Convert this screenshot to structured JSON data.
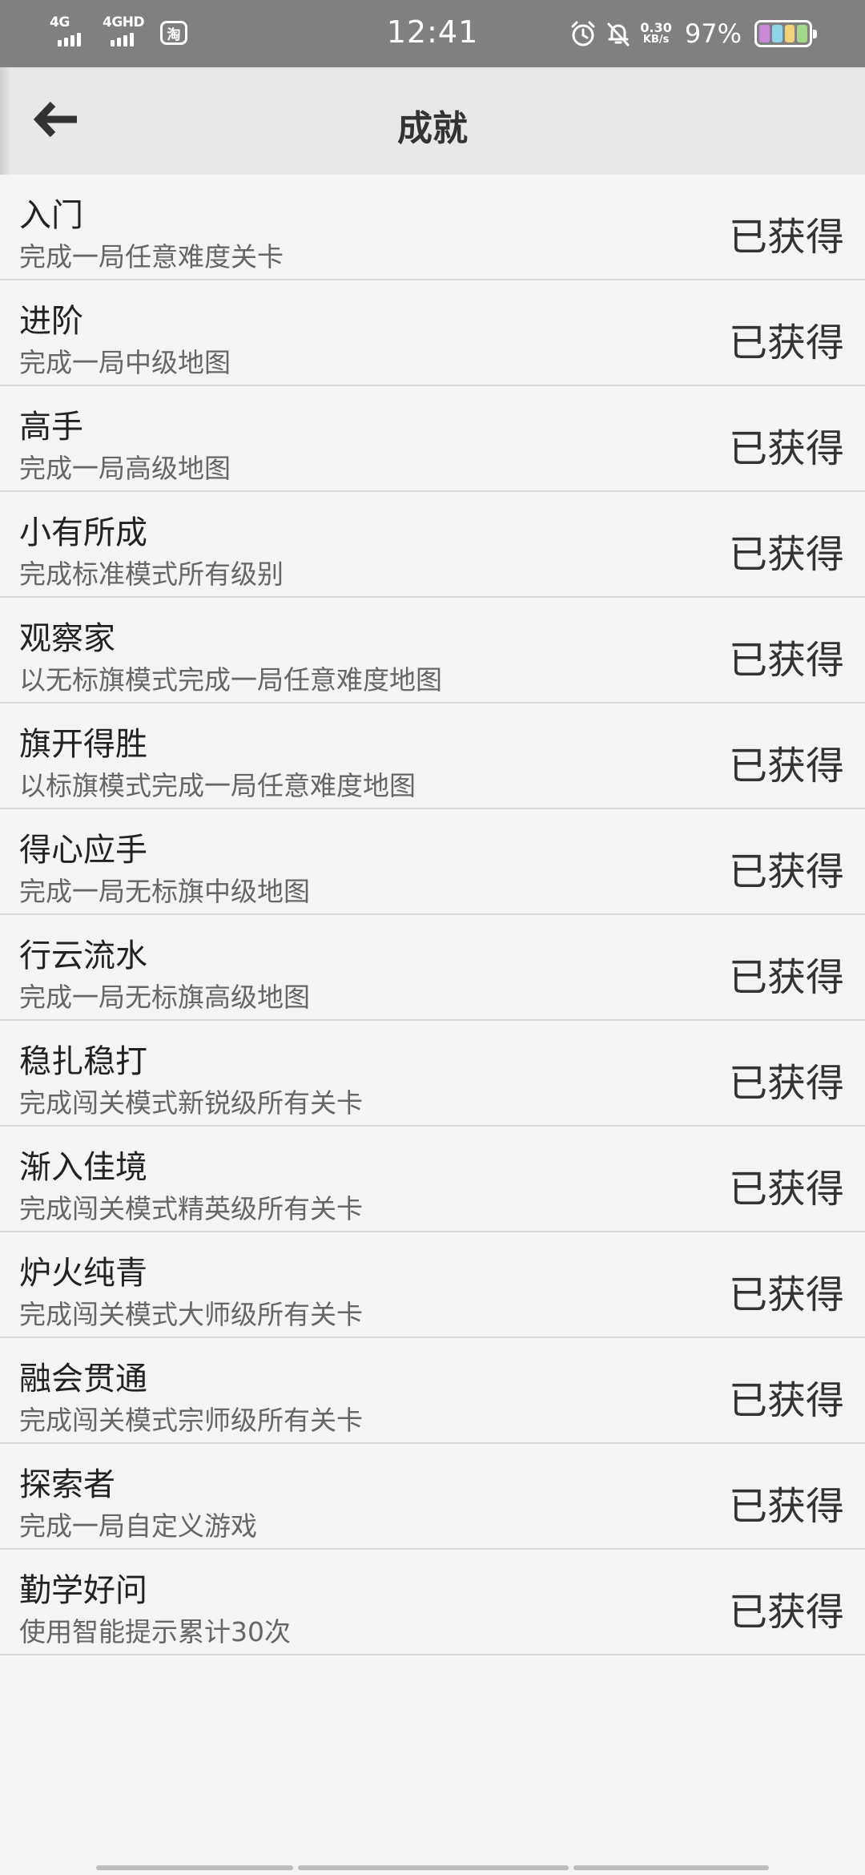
{
  "status_bar": {
    "sim1": "4G",
    "sim2": "4GHD",
    "app_badge": "淘",
    "time": "12:41",
    "speed_value": "0.30",
    "speed_unit": "KB/s",
    "battery": "97%",
    "icons": [
      "alarm-icon",
      "mute-bell-icon",
      "battery-icon"
    ]
  },
  "header": {
    "title": "成就",
    "back_icon": "arrow-left-icon"
  },
  "achievements": [
    {
      "title": "入门",
      "desc": "完成一局任意难度关卡",
      "status": "已获得"
    },
    {
      "title": "进阶",
      "desc": "完成一局中级地图",
      "status": "已获得"
    },
    {
      "title": "高手",
      "desc": "完成一局高级地图",
      "status": "已获得"
    },
    {
      "title": "小有所成",
      "desc": "完成标准模式所有级别",
      "status": "已获得"
    },
    {
      "title": "观察家",
      "desc": "以无标旗模式完成一局任意难度地图",
      "status": "已获得"
    },
    {
      "title": "旗开得胜",
      "desc": "以标旗模式完成一局任意难度地图",
      "status": "已获得"
    },
    {
      "title": "得心应手",
      "desc": "完成一局无标旗中级地图",
      "status": "已获得"
    },
    {
      "title": "行云流水",
      "desc": "完成一局无标旗高级地图",
      "status": "已获得"
    },
    {
      "title": "稳扎稳打",
      "desc": "完成闯关模式新锐级所有关卡",
      "status": "已获得"
    },
    {
      "title": "渐入佳境",
      "desc": "完成闯关模式精英级所有关卡",
      "status": "已获得"
    },
    {
      "title": "炉火纯青",
      "desc": "完成闯关模式大师级所有关卡",
      "status": "已获得"
    },
    {
      "title": "融会贯通",
      "desc": "完成闯关模式宗师级所有关卡",
      "status": "已获得"
    },
    {
      "title": "探索者",
      "desc": "完成一局自定义游戏",
      "status": "已获得"
    },
    {
      "title": "勤学好问",
      "desc": "使用智能提示累计30次",
      "status": "已获得"
    }
  ],
  "colors": {
    "status_bar_bg": "#808080",
    "header_bg": "#e8e8e8",
    "list_bg": "#f4f4f4",
    "divider": "#d8d8d8",
    "battery_cells": [
      "#c98bd8",
      "#8fd3e8",
      "#f0d27a",
      "#a5d98a"
    ]
  }
}
